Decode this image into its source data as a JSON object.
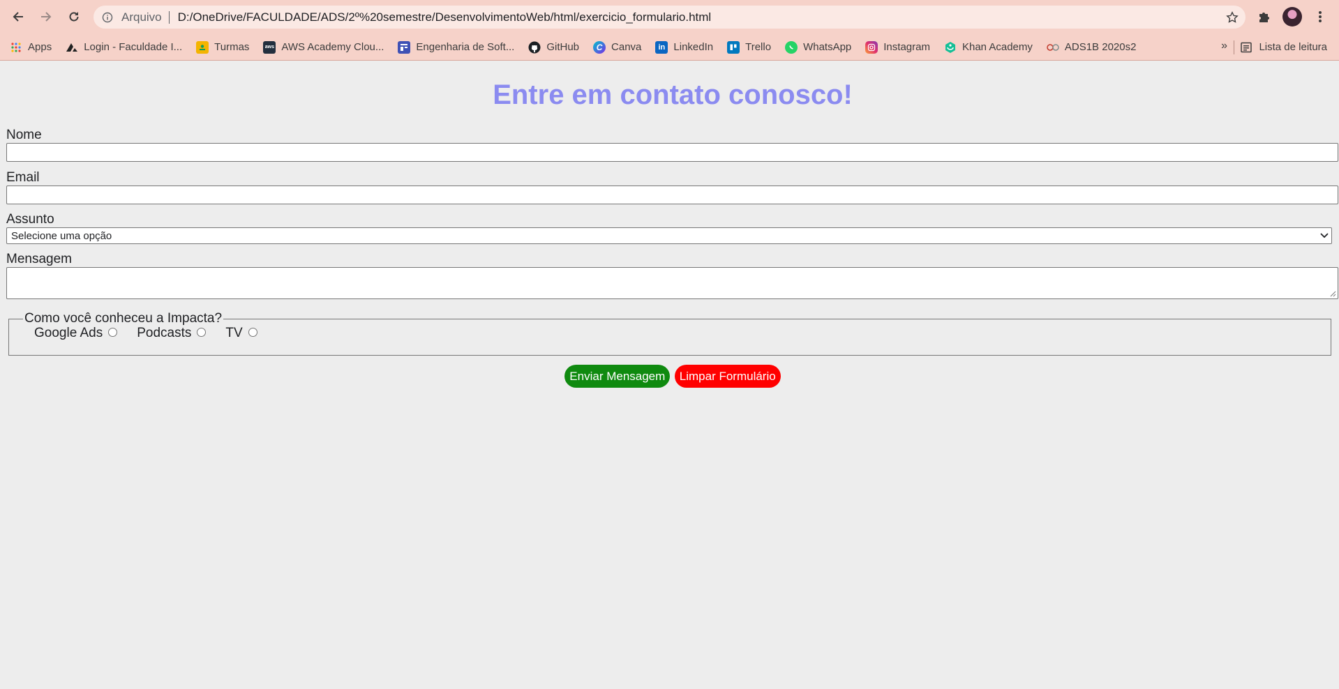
{
  "browser": {
    "info_chip": "Arquivo",
    "url": "D:/OneDrive/FACULDADE/ADS/2º%20semestre/DesenvolvimentoWeb/html/exercicio_formulario.html",
    "bookmarks": [
      {
        "label": "Apps",
        "icon": "apps-grid-icon"
      },
      {
        "label": "Login - Faculdade I...",
        "icon": "faculdade-logo-icon"
      },
      {
        "label": "Turmas",
        "icon": "classroom-icon"
      },
      {
        "label": "AWS Academy Clou...",
        "icon": "aws-icon"
      },
      {
        "label": "Engenharia de Soft...",
        "icon": "forms-icon"
      },
      {
        "label": "GitHub",
        "icon": "github-icon"
      },
      {
        "label": "Canva",
        "icon": "canva-icon"
      },
      {
        "label": "LinkedIn",
        "icon": "linkedin-icon"
      },
      {
        "label": "Trello",
        "icon": "trello-icon"
      },
      {
        "label": "WhatsApp",
        "icon": "whatsapp-icon"
      },
      {
        "label": "Instagram",
        "icon": "instagram-icon"
      },
      {
        "label": "Khan Academy",
        "icon": "khan-academy-icon"
      },
      {
        "label": "ADS1B 2020s2",
        "icon": "ads-icon"
      }
    ],
    "more_label": "»",
    "reading_list": "Lista de leitura"
  },
  "form": {
    "title": "Entre em contato conosco!",
    "name_label": "Nome",
    "email_label": "Email",
    "subject_label": "Assunto",
    "subject_selected": "Selecione uma opção",
    "message_label": "Mensagem",
    "legend": "Como você conheceu a Impacta?",
    "radios": [
      {
        "label": "Google Ads"
      },
      {
        "label": "Podcasts"
      },
      {
        "label": "TV"
      }
    ],
    "submit_label": "Enviar Mensagem",
    "reset_label": "Limpar Formulário"
  },
  "colors": {
    "title": "#8b8bf0",
    "submit": "#0f8a0f",
    "reset": "#ff0000",
    "chrome": "#f6d2c9"
  }
}
